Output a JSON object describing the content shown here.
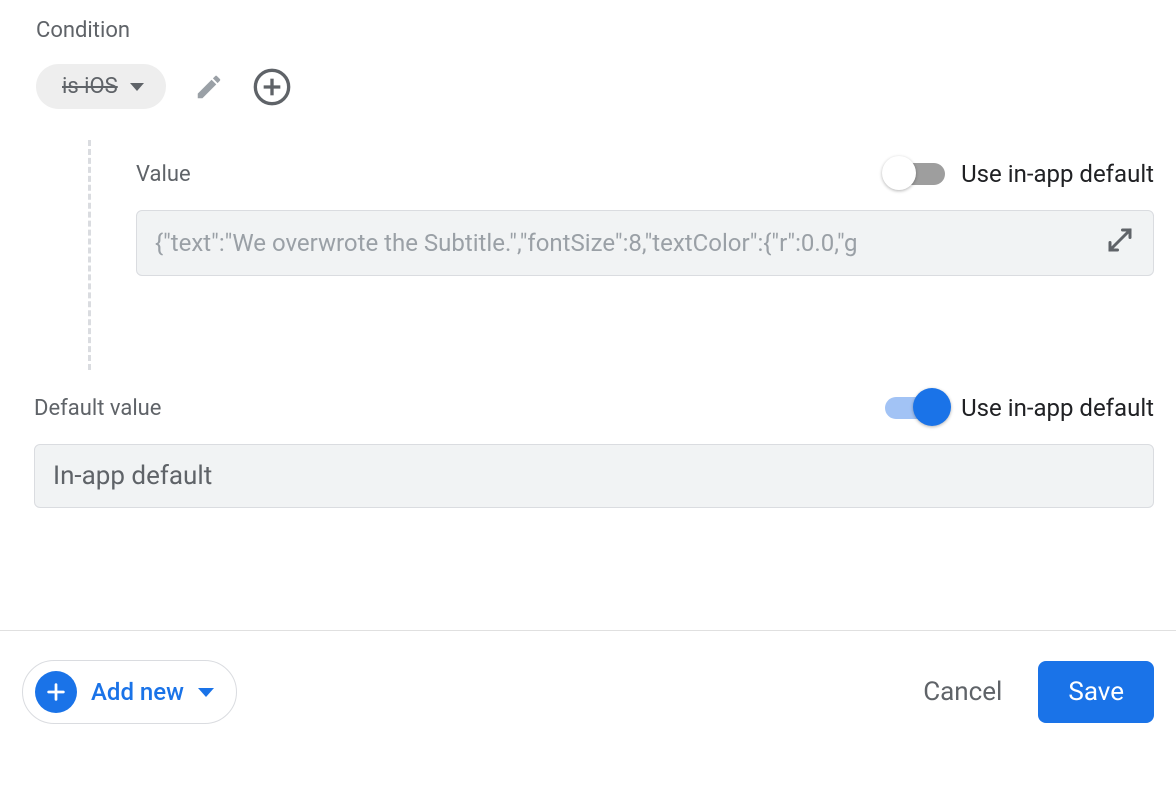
{
  "condition": {
    "label": "Condition",
    "chip_text": "is iOS"
  },
  "value": {
    "label": "Value",
    "toggle_label": "Use in-app default",
    "toggle_on": false,
    "input_value": "{\"text\":\"We overwrote the Subtitle.\",\"fontSize\":8,\"textColor\":{\"r\":0.0,\"g"
  },
  "default_value": {
    "label": "Default value",
    "toggle_label": "Use in-app default",
    "toggle_on": true,
    "input_value": "In-app default"
  },
  "footer": {
    "add_new_label": "Add new",
    "cancel_label": "Cancel",
    "save_label": "Save"
  }
}
